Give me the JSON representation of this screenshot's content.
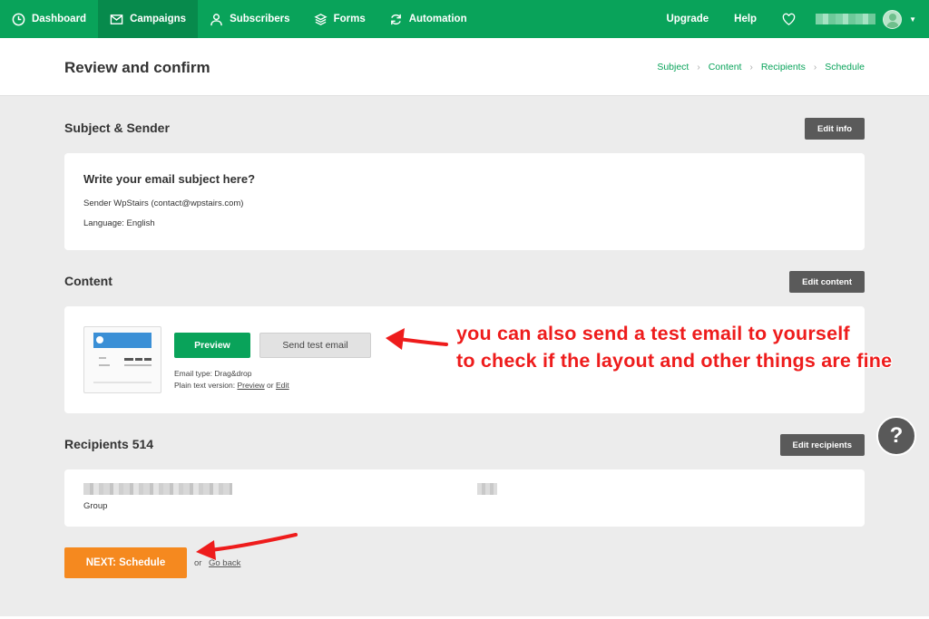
{
  "nav": {
    "items": [
      {
        "label": "Dashboard",
        "icon": "clock-icon"
      },
      {
        "label": "Campaigns",
        "icon": "mail-icon",
        "active": true
      },
      {
        "label": "Subscribers",
        "icon": "user-icon"
      },
      {
        "label": "Forms",
        "icon": "layers-icon"
      },
      {
        "label": "Automation",
        "icon": "refresh-icon"
      }
    ],
    "upgrade": "Upgrade",
    "help": "Help"
  },
  "header": {
    "title": "Review and confirm",
    "breadcrumb": [
      "Subject",
      "Content",
      "Recipients",
      "Schedule"
    ]
  },
  "subject_section": {
    "title": "Subject & Sender",
    "edit_label": "Edit info",
    "subject": "Write your email subject here?",
    "sender": "Sender WpStairs (contact@wpstairs.com)",
    "language": "Language: English"
  },
  "content_section": {
    "title": "Content",
    "edit_label": "Edit content",
    "preview_label": "Preview",
    "test_label": "Send test email",
    "email_type": "Email type: Drag&drop",
    "plain_prefix": "Plain text version: ",
    "plain_preview": "Preview",
    "plain_or": " or ",
    "plain_edit": "Edit"
  },
  "recipients_section": {
    "title": "Recipients 514",
    "edit_label": "Edit recipients",
    "group_label": "Group"
  },
  "footer": {
    "next_label": "NEXT: Schedule",
    "or_label": "or",
    "back_label": "Go back"
  },
  "help_button": "?",
  "annotation": {
    "line1": "you can also send a test email to yourself",
    "line2": "to check if the layout and other things are fine",
    "color": "#ee1c1c"
  },
  "colors": {
    "brand": "#09a35a",
    "next": "#f5891f"
  }
}
